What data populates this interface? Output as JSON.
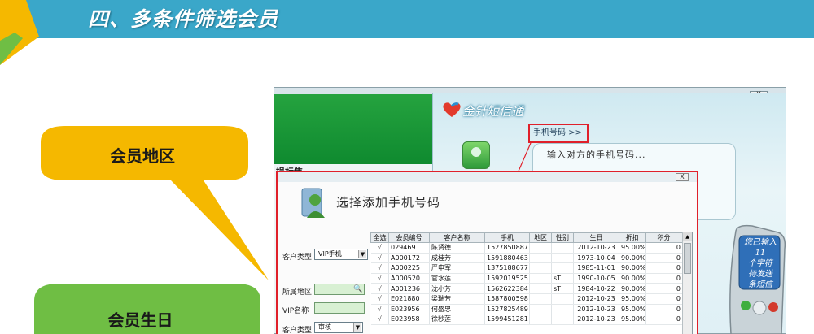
{
  "slide": {
    "title": "四、多条件筛选会员",
    "callouts": [
      {
        "label": "会员地区"
      },
      {
        "label": "会员生日"
      }
    ],
    "colors": {
      "header": "#3aa7c9",
      "callout_yellow": "#f5b800",
      "callout_green": "#6fbe44",
      "highlight_red": "#e0202a"
    }
  },
  "app": {
    "close_label": "X",
    "left_label": "损标焦",
    "sms_title": "金针短信通",
    "phone_tab_label": "手机号码 >>",
    "phone_hint": "输入对方的手机号码...",
    "cellphone_screen_lines": [
      "您已输入",
      "11",
      "个字符",
      "待发送",
      "条短信"
    ]
  },
  "dialog": {
    "close_label": "X",
    "title": "选择添加手机号码",
    "filters": [
      {
        "label": "客户类型",
        "value": "VIP手机"
      },
      {
        "label": "所属地区",
        "value": ""
      },
      {
        "label": "VIP名称",
        "value": ""
      },
      {
        "label": "客户类型",
        "value": "审核"
      }
    ],
    "table": {
      "columns": [
        "全选",
        "会员编号",
        "客户名称",
        "手机",
        "地区",
        "性别",
        "生日",
        "折扣",
        "积分"
      ],
      "rows": [
        [
          "√",
          "029469",
          "陈贤德",
          "1527850887",
          "",
          "",
          "2012-10-23",
          "95.00%",
          "0"
        ],
        [
          "√",
          "A000172",
          "成桂芳",
          "1591880463",
          "",
          "",
          "1973-10-04",
          "90.00%",
          "0"
        ],
        [
          "√",
          "A000225",
          "严申军",
          "1375188677",
          "",
          "",
          "1985-11-01",
          "90.00%",
          "0"
        ],
        [
          "√",
          "A000520",
          "官水莲",
          "1592019525",
          "",
          "sT",
          "1990-10-05",
          "90.00%",
          "0"
        ],
        [
          "√",
          "A001236",
          "沈小芳",
          "1562622384",
          "",
          "sT",
          "1984-10-22",
          "90.00%",
          "0"
        ],
        [
          "√",
          "E021880",
          "梁瑞芳",
          "1587800598",
          "",
          "",
          "2012-10-23",
          "95.00%",
          "0"
        ],
        [
          "√",
          "E023956",
          "何盛忠",
          "1527825489",
          "",
          "",
          "2012-10-23",
          "95.00%",
          "0"
        ],
        [
          "√",
          "E023958",
          "徐秒莲",
          "1599451281",
          "",
          "",
          "2012-10-23",
          "95.00%",
          "0"
        ]
      ]
    },
    "scroll_up_label": "▲"
  }
}
